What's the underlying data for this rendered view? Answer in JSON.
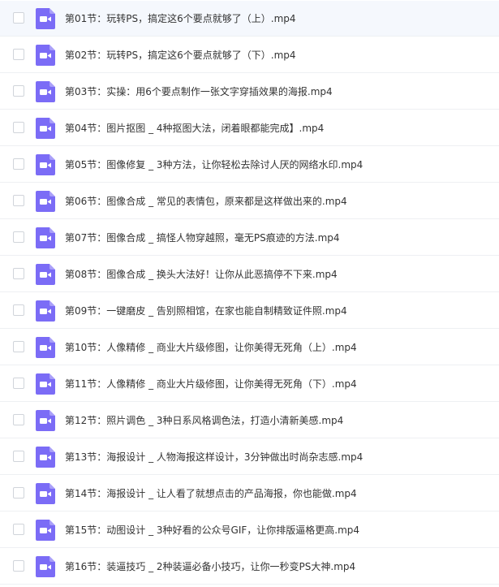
{
  "colors": {
    "icon_fill": "#7b6cf6",
    "icon_glyph": "#ffffff",
    "selected_row_bg": "#f5f8fd",
    "row_divider": "#eef0f3",
    "text": "#333333"
  },
  "file_icon": "video-file-icon",
  "files": [
    {
      "name": "第01节：玩转PS，搞定这6个要点就够了（上）.mp4"
    },
    {
      "name": "第02节：玩转PS，搞定这6个要点就够了（下）.mp4"
    },
    {
      "name": "第03节：实操：用6个要点制作一张文字穿插效果的海报.mp4"
    },
    {
      "name": "第04节：图片抠图 _ 4种抠图大法，闭着眼都能完成】.mp4"
    },
    {
      "name": "第05节：图像修复 _ 3种方法，让你轻松去除讨人厌的网络水印.mp4"
    },
    {
      "name": "第06节：图像合成 _ 常见的表情包，原来都是这样做出来的.mp4"
    },
    {
      "name": "第07节：图像合成 _ 搞怪人物穿越照，毫无PS痕迹的方法.mp4"
    },
    {
      "name": "第08节：图像合成 _ 换头大法好！让你从此恶搞停不下来.mp4"
    },
    {
      "name": "第09节：一键磨皮 _ 告别照相馆，在家也能自制精致证件照.mp4"
    },
    {
      "name": "第10节：人像精修 _ 商业大片级修图，让你美得无死角（上）.mp4"
    },
    {
      "name": "第11节：人像精修 _ 商业大片级修图，让你美得无死角（下）.mp4"
    },
    {
      "name": "第12节：照片调色 _ 3种日系风格调色法，打造小清新美感.mp4"
    },
    {
      "name": "第13节：海报设计 _ 人物海报这样设计，3分钟做出时尚杂志感.mp4"
    },
    {
      "name": "第14节：海报设计 _ 让人看了就想点击的产品海报，你也能做.mp4"
    },
    {
      "name": "第15节：动图设计 _ 3种好看的公众号GIF，让你排版逼格更高.mp4"
    },
    {
      "name": "第16节：装逼技巧 _ 2种装逼必备小技巧，让你一秒变PS大神.mp4"
    }
  ]
}
